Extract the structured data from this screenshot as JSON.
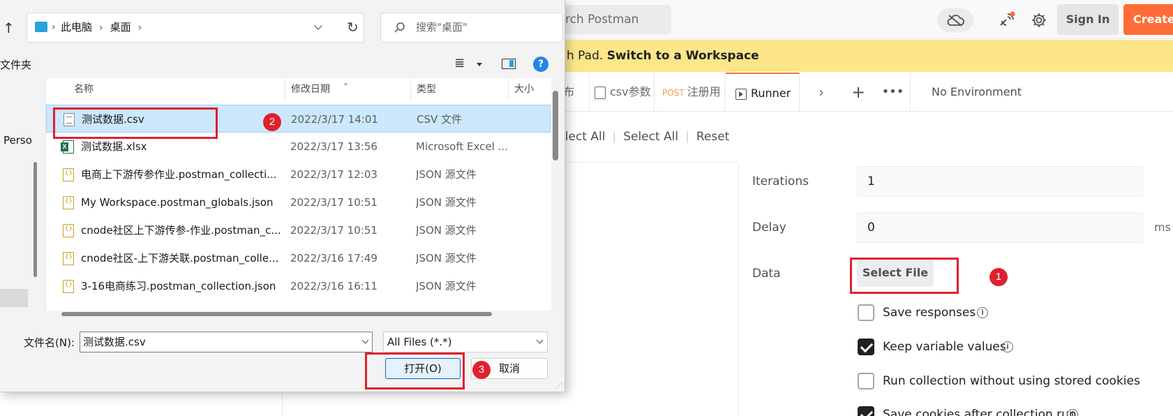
{
  "postman": {
    "search_placeholder": "rch Postman",
    "sign_in": "Sign In",
    "create_account": "Create A",
    "banner_text": "h Pad. ",
    "banner_link": "Switch to a Workspace",
    "tabs": [
      {
        "label": "布"
      },
      {
        "label": "csv参数"
      },
      {
        "method": "POST",
        "label": "注册用"
      },
      {
        "label": "Runner"
      }
    ],
    "environment": "No Environment",
    "runner_actions": [
      "eselect All",
      "Select All",
      "Reset"
    ],
    "left_edge_text": "Perso",
    "settings": {
      "iterations_label": "Iterations",
      "iterations_value": "1",
      "delay_label": "Delay",
      "delay_value": "0",
      "delay_unit": "ms",
      "data_label": "Data",
      "select_file": "Select File"
    },
    "options": [
      {
        "label": "Save responses",
        "checked": false
      },
      {
        "label": "Keep variable values",
        "checked": true
      },
      {
        "label": "Run collection without using stored cookies",
        "checked": false
      },
      {
        "label": "Save cookies after collection run",
        "checked": true
      }
    ]
  },
  "dialog": {
    "breadcrumb": [
      "此电脑",
      "桌面"
    ],
    "search_placeholder": "搜索\"桌面\"",
    "sidebar_label": "文件夹",
    "columns": [
      "名称",
      "修改日期",
      "类型",
      "大小"
    ],
    "files": [
      {
        "name": "测试数据.csv",
        "date": "2022/3/17 14:01",
        "type": "CSV 文件",
        "icon": "csv-file-icon",
        "selected": true
      },
      {
        "name": "测试数据.xlsx",
        "date": "2022/3/17 13:56",
        "type": "Microsoft Excel ...",
        "icon": "excel-file-icon",
        "selected": false
      },
      {
        "name": "电商上下游传参作业.postman_collecti...",
        "date": "2022/3/17 12:03",
        "type": "JSON 源文件",
        "icon": "json-file-icon",
        "selected": false
      },
      {
        "name": "My Workspace.postman_globals.json",
        "date": "2022/3/17 10:51",
        "type": "JSON 源文件",
        "icon": "json-file-icon",
        "selected": false
      },
      {
        "name": "cnode社区上下游传参-作业.postman_c...",
        "date": "2022/3/17 10:51",
        "type": "JSON 源文件",
        "icon": "json-file-icon",
        "selected": false
      },
      {
        "name": "cnode社区-上下游关联.postman_colle...",
        "date": "2022/3/16 17:49",
        "type": "JSON 源文件",
        "icon": "json-file-icon",
        "selected": false
      },
      {
        "name": "3-16电商练习.postman_collection.json",
        "date": "2022/3/16 16:11",
        "type": "JSON 源文件",
        "icon": "json-file-icon",
        "selected": false
      }
    ],
    "filename_label": "文件名(N):",
    "filename_value": "测试数据.csv",
    "filetype_value": "All Files (*.*)",
    "open_button": "打开(O)",
    "cancel_button": "取消"
  },
  "annotations": [
    "1",
    "2",
    "3"
  ],
  "colors": {
    "accent": "#ff6c37",
    "banner": "#fde68a",
    "annotation_red": "#e0202e",
    "selection": "#cce8ff"
  }
}
